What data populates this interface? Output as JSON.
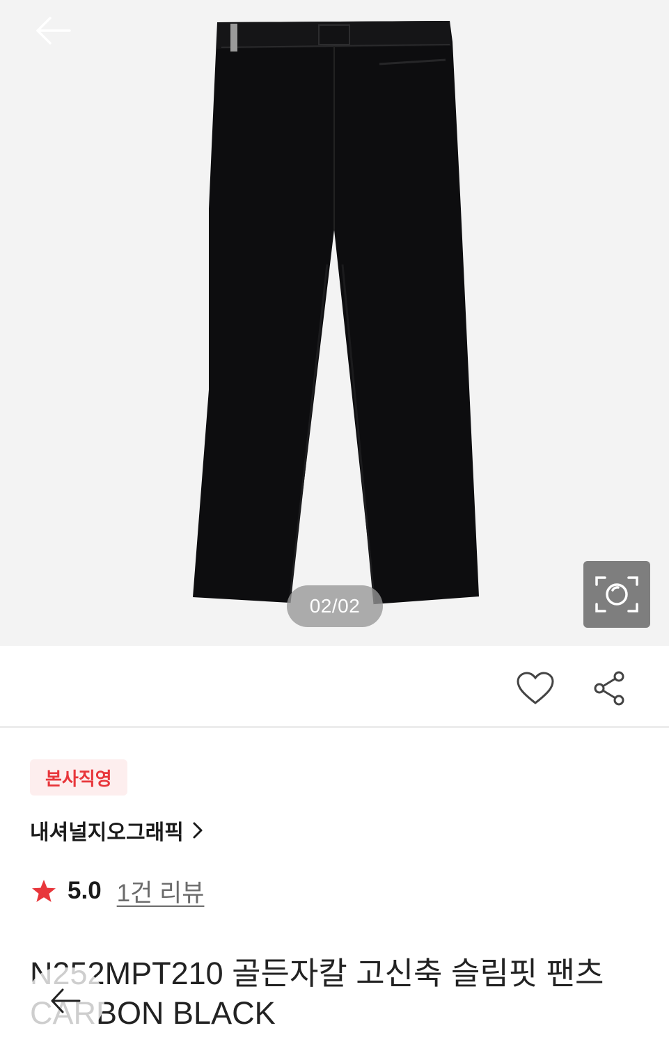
{
  "gallery": {
    "page_indicator": "02/02"
  },
  "product": {
    "badge": "본사직영",
    "brand": "내셔널지오그래픽",
    "rating": "5.0",
    "review_link": "1건 리뷰",
    "title": "N252MPT210 골든자칼 고신축 슬림핏 팬츠 CARBON BLACK"
  },
  "icons": {
    "back": "arrow-left-icon",
    "image_search": "camera-scan-icon",
    "wish": "heart-outline-icon",
    "share": "share-icon",
    "brand_more": "chevron-right-icon",
    "rating": "star-icon"
  },
  "colors": {
    "accent": "#e8363b",
    "badge_bg": "#fdeeee",
    "image_bg": "#f3f3f3"
  }
}
